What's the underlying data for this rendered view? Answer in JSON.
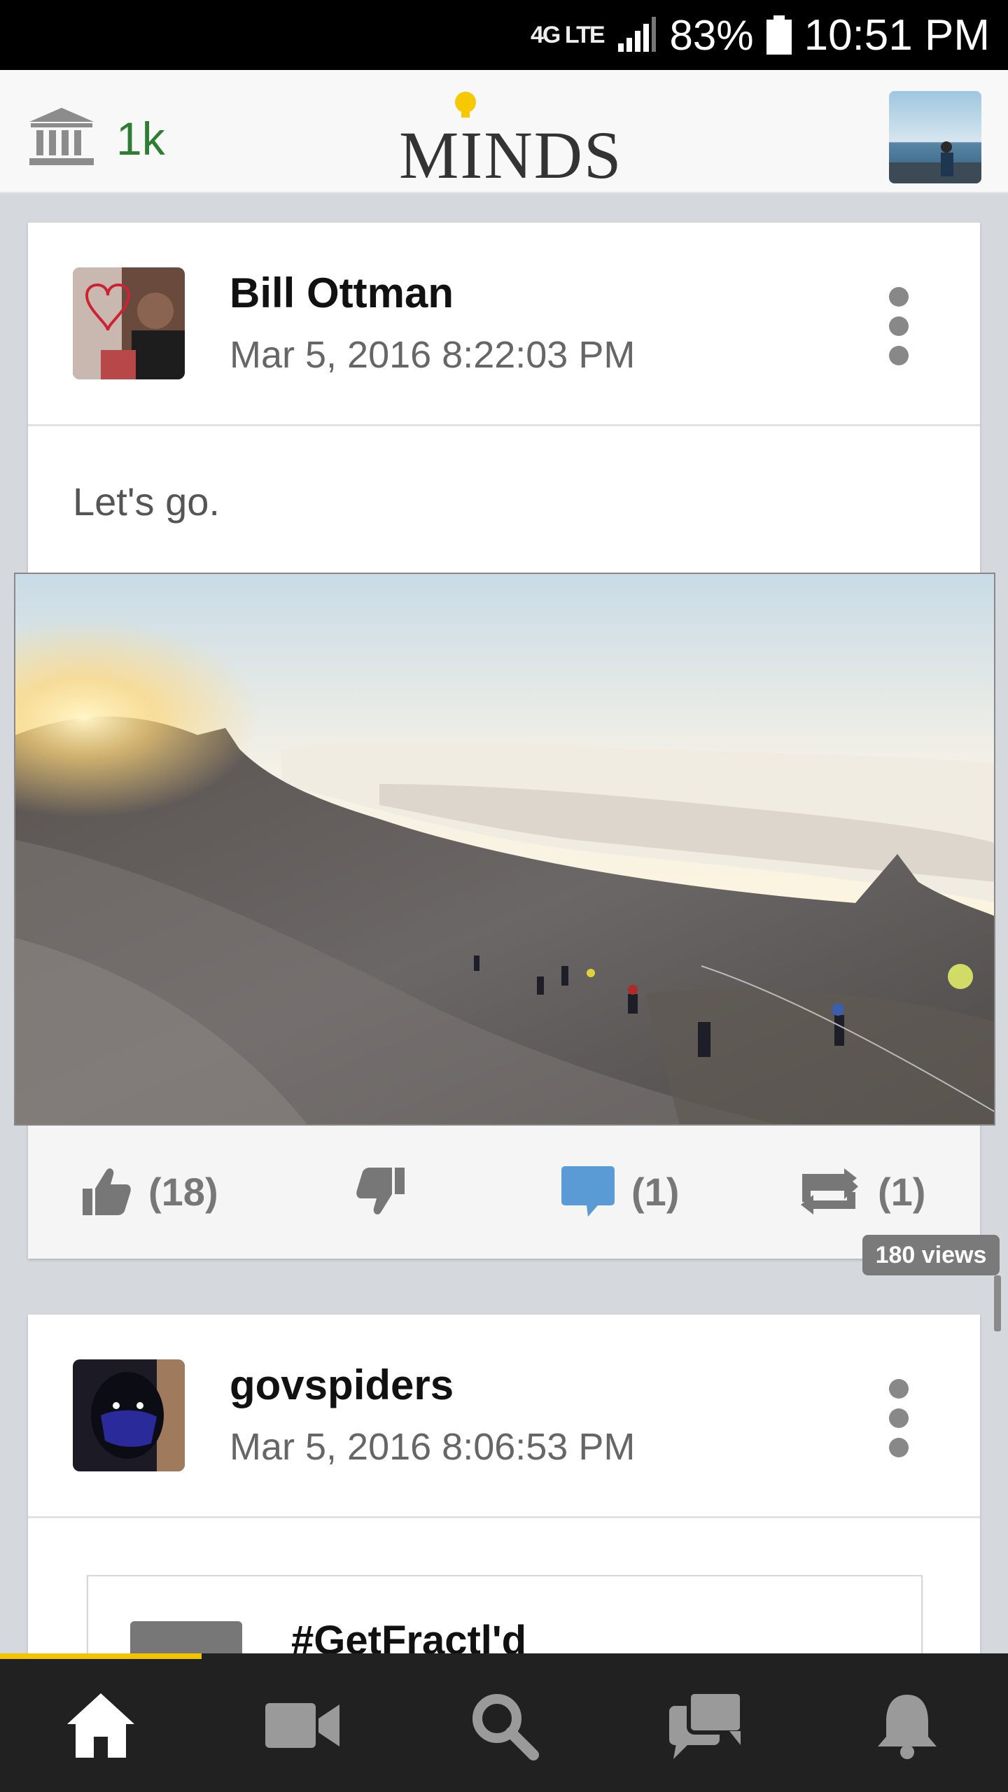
{
  "status_bar": {
    "network": "4G LTE",
    "battery_percent": "83%",
    "time": "10:51 PM"
  },
  "header": {
    "points": "1k",
    "logo_text": "MINDS",
    "icons": {
      "left": "bank-icon",
      "logo_accent": "lightbulb-icon",
      "right": "user-avatar"
    }
  },
  "feed": [
    {
      "owner_name": "Bill Ottman",
      "timestamp": "Mar 5, 2016 8:22:03 PM",
      "text": "Let's go.",
      "image": "mountain-summit-sunrise-photo",
      "actions": {
        "thumbs_up_count": "(18)",
        "comment_count": "(1)",
        "remind_count": "(1)"
      },
      "views": "180 views"
    },
    {
      "owner_name": "govspiders",
      "timestamp": "Mar 5, 2016 8:06:53 PM",
      "embed_title": "#GetFractl'd"
    }
  ],
  "bottom_nav": {
    "items": [
      "home-icon",
      "video-icon",
      "search-icon",
      "messenger-icon",
      "notifications-icon"
    ],
    "active": "home-icon"
  },
  "colors": {
    "accent_yellow": "#f2c500",
    "points_green": "#2e7d32",
    "comment_blue": "#5b9bd5",
    "nav_bg": "#212121"
  }
}
